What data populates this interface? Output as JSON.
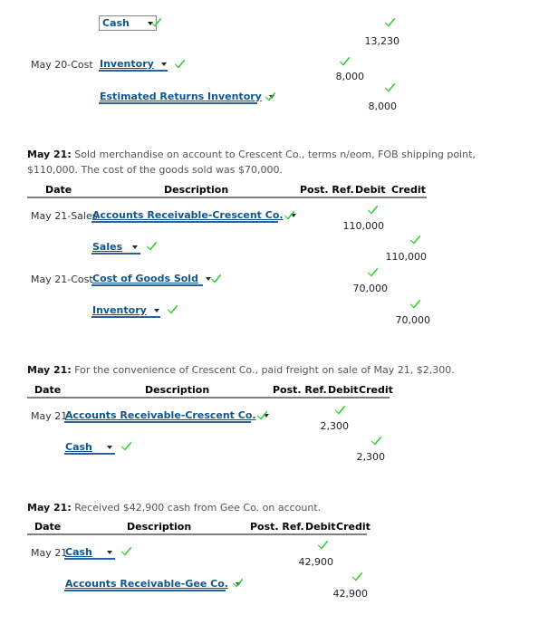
{
  "colors": {
    "check_green": "#2fd02f",
    "account_link": "#11558d",
    "account_underline": "#2b5f9e",
    "rule": "#808080",
    "body_text": "#555555"
  },
  "columns": {
    "date": "Date",
    "description": "Description",
    "post_ref": "Post. Ref.",
    "debit": "Debit",
    "credit": "Credit"
  },
  "sections": [
    {
      "id": "may-20-cost",
      "prompt": null,
      "has_header": false,
      "rows": [
        {
          "date": "",
          "account": "Cash",
          "boxed": true,
          "indent": true,
          "debit": "",
          "credit": "13,230"
        },
        {
          "date": "May 20-Cost",
          "account": "Inventory",
          "boxed": false,
          "indent": false,
          "debit": "8,000",
          "credit": ""
        },
        {
          "date": "",
          "account": "Estimated Returns Inventory",
          "boxed": false,
          "indent": false,
          "debit": "",
          "credit": "8,000"
        }
      ]
    },
    {
      "id": "may-21-sold",
      "prompt_lead": "May 21:",
      "prompt_body": " Sold merchandise on account to Crescent Co., terms n/eom, FOB shipping point, $110,000. The cost of the goods sold was $70,000.",
      "has_header": true,
      "rows": [
        {
          "date": "May 21-Sales",
          "account": "Accounts Receivable-Crescent Co.",
          "boxed": false,
          "indent": false,
          "debit": "110,000",
          "credit": ""
        },
        {
          "date": "",
          "account": "Sales",
          "boxed": false,
          "indent": true,
          "debit": "",
          "credit": "110,000"
        },
        {
          "date": "May 21-Cost",
          "account": "Cost of Goods Sold",
          "boxed": false,
          "indent": false,
          "debit": "70,000",
          "credit": ""
        },
        {
          "date": "",
          "account": "Inventory",
          "boxed": false,
          "indent": true,
          "debit": "",
          "credit": "70,000"
        }
      ]
    },
    {
      "id": "may-21-freight",
      "prompt_lead": "May 21:",
      "prompt_body": " For the convenience of Crescent Co., paid freight on sale of May 21, $2,300.",
      "has_header": true,
      "rows": [
        {
          "date": "May 21",
          "account": "Accounts Receivable-Crescent Co.",
          "boxed": false,
          "indent": false,
          "debit": "2,300",
          "credit": ""
        },
        {
          "date": "",
          "account": "Cash",
          "boxed": false,
          "indent": true,
          "debit": "",
          "credit": "2,300"
        }
      ]
    },
    {
      "id": "may-21-received",
      "prompt_lead": "May 21:",
      "prompt_body": " Received $42,900 cash from Gee Co. on account.",
      "has_header": true,
      "rows": [
        {
          "date": "May 21",
          "account": "Cash",
          "boxed": false,
          "indent": false,
          "debit": "42,900",
          "credit": ""
        },
        {
          "date": "",
          "account": "Accounts Receivable-Gee Co.",
          "boxed": false,
          "indent": true,
          "debit": "",
          "credit": "42,900"
        }
      ]
    }
  ],
  "icons": {
    "check": "check-mark-icon",
    "dropdown_arrow": "chevron-down-icon"
  }
}
